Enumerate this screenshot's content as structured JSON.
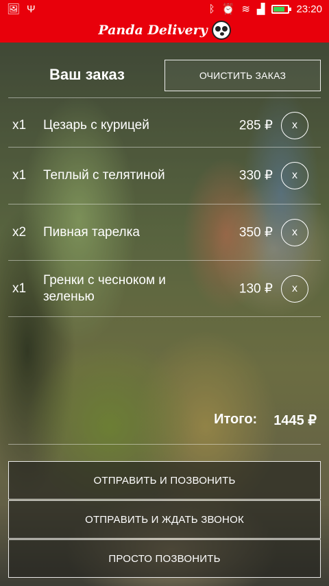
{
  "status_bar": {
    "time": "23:20",
    "battery_color": "#39d353"
  },
  "app_bar": {
    "title": "Panda Delivery",
    "brand_color": "#e8000b"
  },
  "order": {
    "title": "Ваш заказ",
    "clear_button": "ОЧИСТИТЬ ЗАКАЗ",
    "items": [
      {
        "qty": "x1",
        "name": "Цезарь с курицей",
        "price": "285 ₽",
        "remove": "x"
      },
      {
        "qty": "x1",
        "name": "Теплый с телятиной",
        "price": "330 ₽",
        "remove": "x"
      },
      {
        "qty": "x2",
        "name": "Пивная тарелка",
        "price": "350 ₽",
        "remove": "x"
      },
      {
        "qty": "x1",
        "name": "Гренки с чесноком и зеленью",
        "price": "130 ₽",
        "remove": "x"
      }
    ],
    "total_label": "Итого:",
    "total_value": "1445 ₽"
  },
  "actions": {
    "send_and_call": "ОТПРАВИТЬ И ПОЗВОНИТЬ",
    "send_and_wait": "ОТПРАВИТЬ И ЖДАТЬ ЗВОНОК",
    "just_call": "ПРОСТО ПОЗВОНИТЬ"
  }
}
